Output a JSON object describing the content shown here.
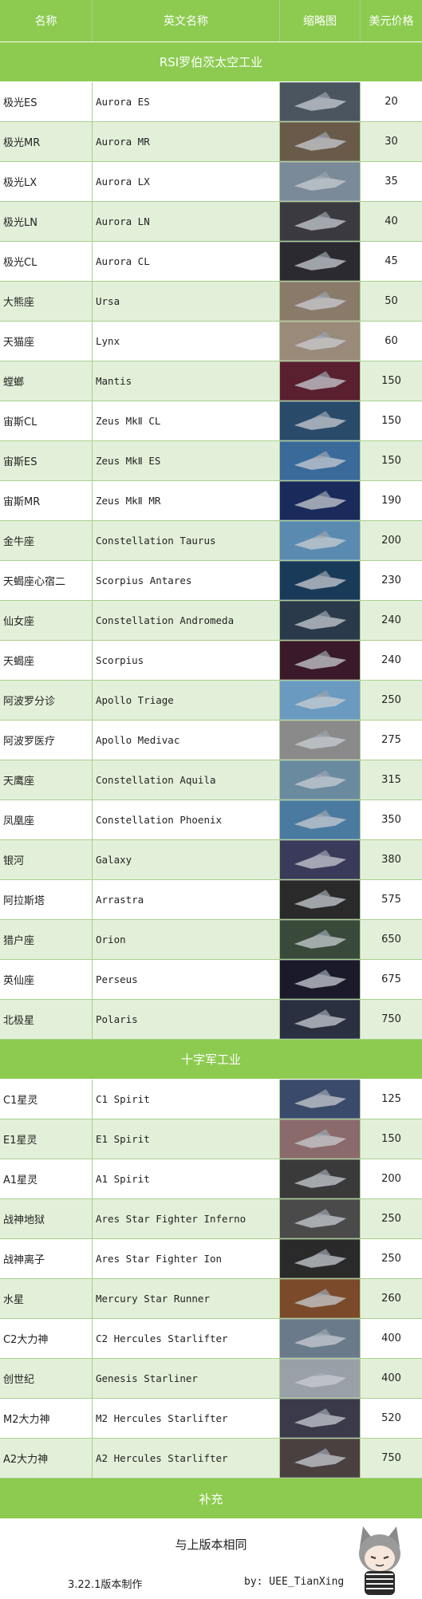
{
  "header": {
    "name": "名称",
    "en_name": "英文名称",
    "thumb": "缩略图",
    "price": "美元价格"
  },
  "sections": [
    {
      "title": "RSI罗伯茨太空工业",
      "rows": [
        {
          "cn": "极光ES",
          "en": "Aurora ES",
          "price": "20",
          "thumb_color": "#4a5560"
        },
        {
          "cn": "极光MR",
          "en": "Aurora MR",
          "price": "30",
          "thumb_color": "#6a5a4a"
        },
        {
          "cn": "极光LX",
          "en": "Aurora LX",
          "price": "35",
          "thumb_color": "#7a8a98"
        },
        {
          "cn": "极光LN",
          "en": "Aurora LN",
          "price": "40",
          "thumb_color": "#3a3a40"
        },
        {
          "cn": "极光CL",
          "en": "Aurora CL",
          "price": "45",
          "thumb_color": "#2a2a30"
        },
        {
          "cn": "大熊座",
          "en": "Ursa",
          "price": "50",
          "thumb_color": "#8a7a6a"
        },
        {
          "cn": "天猫座",
          "en": "Lynx",
          "price": "60",
          "thumb_color": "#9a8a7a"
        },
        {
          "cn": "螳螂",
          "en": "Mantis",
          "price": "150",
          "thumb_color": "#5a2030"
        },
        {
          "cn": "宙斯CL",
          "en": "Zeus MkⅡ CL",
          "price": "150",
          "thumb_color": "#2a4a6a"
        },
        {
          "cn": "宙斯ES",
          "en": "Zeus MkⅡ ES",
          "price": "150",
          "thumb_color": "#3a6a9a"
        },
        {
          "cn": "宙斯MR",
          "en": "Zeus MkⅡ MR",
          "price": "190",
          "thumb_color": "#1a2a5a"
        },
        {
          "cn": "金牛座",
          "en": "Constellation Taurus",
          "price": "200",
          "thumb_color": "#5a8ab0"
        },
        {
          "cn": "天蝎座心宿二",
          "en": "Scorpius Antares",
          "price": "230",
          "thumb_color": "#1a3a5a"
        },
        {
          "cn": "仙女座",
          "en": "Constellation Andromeda",
          "price": "240",
          "thumb_color": "#2a3a4a"
        },
        {
          "cn": "天蝎座",
          "en": "Scorpius",
          "price": "240",
          "thumb_color": "#3a1a2a"
        },
        {
          "cn": "阿波罗分诊",
          "en": "Apollo Triage",
          "price": "250",
          "thumb_color": "#6a9ac0"
        },
        {
          "cn": "阿波罗医疗",
          "en": "Apollo Medivac",
          "price": "275",
          "thumb_color": "#8a8a8a"
        },
        {
          "cn": "天鹰座",
          "en": "Constellation Aquila",
          "price": "315",
          "thumb_color": "#6a8aa0"
        },
        {
          "cn": "凤凰座",
          "en": "Constellation Phoenix",
          "price": "350",
          "thumb_color": "#4a7aa0"
        },
        {
          "cn": "银河",
          "en": "Galaxy",
          "price": "380",
          "thumb_color": "#3a3a5a"
        },
        {
          "cn": "阿拉斯塔",
          "en": "Arrastra",
          "price": "575",
          "thumb_color": "#2a2a2a"
        },
        {
          "cn": "猎户座",
          "en": "Orion",
          "price": "650",
          "thumb_color": "#3a4a3a"
        },
        {
          "cn": "英仙座",
          "en": "Perseus",
          "price": "675",
          "thumb_color": "#1a1a2a"
        },
        {
          "cn": "北极星",
          "en": "Polaris",
          "price": "750",
          "thumb_color": "#2a3040"
        }
      ]
    },
    {
      "title": "十字军工业",
      "rows": [
        {
          "cn": "C1星灵",
          "en": "C1 Spirit",
          "price": "125",
          "thumb_color": "#3a4a6a"
        },
        {
          "cn": "E1星灵",
          "en": "E1 Spirit",
          "price": "150",
          "thumb_color": "#8a6a6a"
        },
        {
          "cn": "A1星灵",
          "en": "A1 Spirit",
          "price": "200",
          "thumb_color": "#3a3a3a"
        },
        {
          "cn": "战神地狱",
          "en": "Ares Star Fighter Inferno",
          "price": "250",
          "thumb_color": "#4a4a4a"
        },
        {
          "cn": "战神离子",
          "en": "Ares Star Fighter Ion",
          "price": "250",
          "thumb_color": "#2a2a2a"
        },
        {
          "cn": "水星",
          "en": "Mercury Star Runner",
          "price": "260",
          "thumb_color": "#7a4a2a"
        },
        {
          "cn": "C2大力神",
          "en": "C2 Hercules Starlifter",
          "price": "400",
          "thumb_color": "#6a7a8a"
        },
        {
          "cn": "创世纪",
          "en": "Genesis Starliner",
          "price": "400",
          "thumb_color": "#9aa0a8"
        },
        {
          "cn": "M2大力神",
          "en": "M2 Hercules Starlifter",
          "price": "520",
          "thumb_color": "#3a3a4a"
        },
        {
          "cn": "A2大力神",
          "en": "A2 Hercules Starlifter",
          "price": "750",
          "thumb_color": "#4a4040"
        }
      ]
    }
  ],
  "supplement": {
    "title": "补充",
    "note": "与上版本相同",
    "version": "3.22.1版本制作",
    "author": "by: UEE_TianXing"
  },
  "colors": {
    "header_green": "#8ccb50",
    "row_alt": "#e3f0d9",
    "border": "#a9cf8e"
  }
}
